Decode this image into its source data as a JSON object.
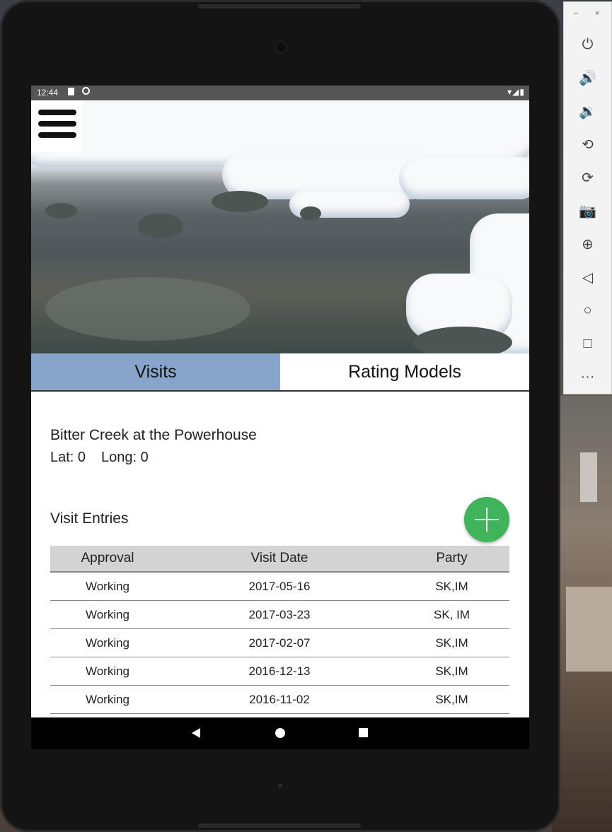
{
  "status_bar": {
    "time": "12:44",
    "right_icons": "▾◢▮"
  },
  "tabs": [
    {
      "label": "Visits",
      "active": true
    },
    {
      "label": "Rating Models",
      "active": false
    }
  ],
  "site": {
    "name": "Bitter Creek at the Powerhouse",
    "lat": "Lat: 0",
    "long": "Long: 0"
  },
  "entries": {
    "title": "Visit Entries",
    "columns": [
      "Approval",
      "Visit Date",
      "Party"
    ],
    "rows": [
      [
        "Working",
        "2017-05-16",
        "SK,IM"
      ],
      [
        "Working",
        "2017-03-23",
        "SK, IM"
      ],
      [
        "Working",
        "2017-02-07",
        "SK,IM"
      ],
      [
        "Working",
        "2016-12-13",
        "SK,IM"
      ],
      [
        "Working",
        "2016-11-02",
        "SK,IM"
      ]
    ]
  },
  "emulator": {
    "minimize": "–",
    "close": "×",
    "tools": [
      {
        "name": "power-icon",
        "glyph": "⏻"
      },
      {
        "name": "volume-up-icon",
        "glyph": "🔊"
      },
      {
        "name": "volume-down-icon",
        "glyph": "🔉"
      },
      {
        "name": "rotate-left-icon",
        "glyph": "⟲"
      },
      {
        "name": "rotate-right-icon",
        "glyph": "⟳"
      },
      {
        "name": "camera-icon",
        "glyph": "📷"
      },
      {
        "name": "zoom-icon",
        "glyph": "⊕"
      },
      {
        "name": "back-icon",
        "glyph": "◁"
      },
      {
        "name": "home-icon",
        "glyph": "○"
      },
      {
        "name": "overview-icon",
        "glyph": "□"
      },
      {
        "name": "more-icon",
        "glyph": "···"
      }
    ]
  },
  "colors": {
    "active_tab": "#87a4ca",
    "add_button": "#3fb45b"
  }
}
